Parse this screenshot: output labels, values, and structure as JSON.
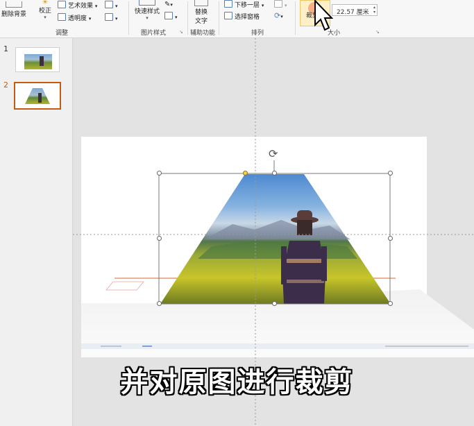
{
  "ribbon": {
    "remove_bg": "删除背景",
    "corrections": "校正",
    "artistic_effects": "艺术效果",
    "transparency": "透明度",
    "adjust_group": "调整",
    "quick_styles": "快速样式",
    "picture_styles_group": "图片样式",
    "alt_text_line1": "替换",
    "alt_text_line2": "文字",
    "accessibility_group": "辅助功能",
    "send_backward": "下移一层",
    "selection_pane": "选择窗格",
    "arrange_group": "排列",
    "crop": "裁剪",
    "width_value": "22.57 厘米",
    "size_group": "大小"
  },
  "slides": [
    {
      "number": "1"
    },
    {
      "number": "2"
    }
  ],
  "subtitle": "并对原图进行裁剪",
  "colors": {
    "selected_thumb_border": "#c55a11",
    "subtitle_text": "#ffffff"
  }
}
